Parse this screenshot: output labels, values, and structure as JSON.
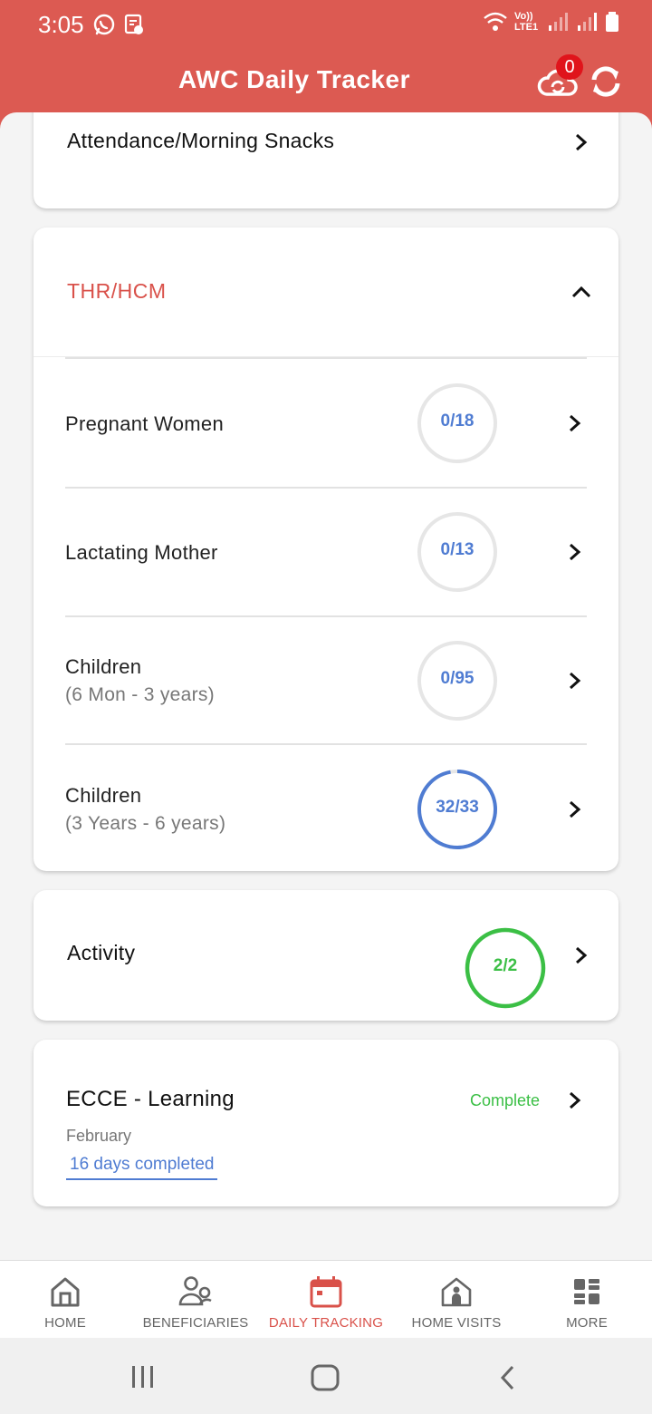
{
  "status": {
    "time": "3:05",
    "net": "Vo)) LTE1"
  },
  "header": {
    "title": "AWC Daily Tracker",
    "sync_badge": "0"
  },
  "cards": {
    "attendance": {
      "title": "Attendance/Morning Snacks"
    },
    "thr": {
      "title": "THR/HCM",
      "title_color": "#d9514a",
      "rows": [
        {
          "title": "Pregnant Women",
          "subtitle": "",
          "count": "0/18",
          "progress": 0
        },
        {
          "title": "Lactating Mother",
          "subtitle": "",
          "count": "0/13",
          "progress": 0
        },
        {
          "title": "Children",
          "subtitle": "(6 Mon - 3 years)",
          "count": "0/95",
          "progress": 0
        },
        {
          "title": "Children",
          "subtitle": "(3 Years - 6 years)",
          "count": "32/33",
          "progress": 0.97
        }
      ]
    },
    "activity": {
      "title": "Activity",
      "count": "2/2",
      "progress": 1.0
    },
    "ecce": {
      "title": "ECCE - Learning",
      "status": "Complete",
      "month": "February",
      "days": "16 days completed"
    }
  },
  "nav": {
    "items": [
      {
        "label": "HOME",
        "icon": "home-icon"
      },
      {
        "label": "BENEFICIARIES",
        "icon": "people-icon"
      },
      {
        "label": "DAILY TRACKING",
        "icon": "calendar-icon",
        "active": true
      },
      {
        "label": "HOME VISITS",
        "icon": "house-person-icon"
      },
      {
        "label": "MORE",
        "icon": "grid-icon"
      }
    ]
  },
  "colors": {
    "header": "#dc5a52",
    "accent_blue": "#4f7cd2",
    "accent_green": "#3bbf45",
    "ring_empty": "#e6e6e6"
  }
}
